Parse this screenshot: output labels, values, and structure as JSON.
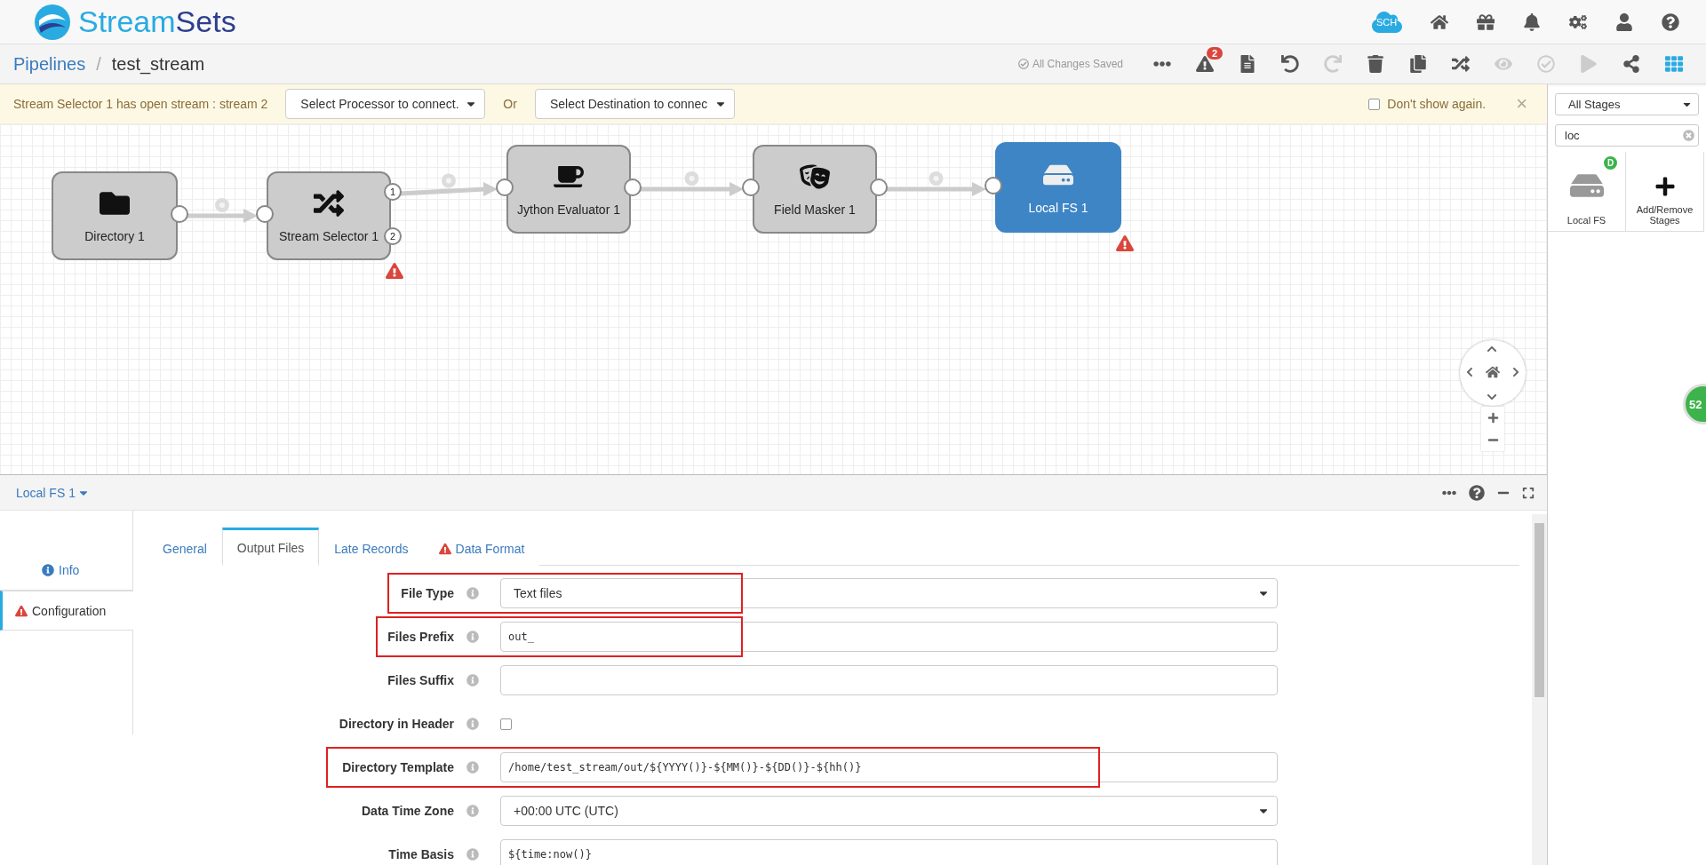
{
  "header": {
    "logo": [
      "Stream",
      "Sets"
    ],
    "icons": [
      {
        "kind": "cloud",
        "label": "SCH"
      },
      {
        "kind": "home"
      },
      {
        "kind": "gift"
      },
      {
        "kind": "bell"
      },
      {
        "kind": "cogs"
      },
      {
        "kind": "user"
      },
      {
        "kind": "help"
      }
    ]
  },
  "breadcrumb": {
    "root": "Pipelines",
    "separator": "/",
    "current": "test_stream"
  },
  "toolbar": {
    "status": "All Changes Saved",
    "buttons": [
      {
        "kind": "more",
        "disabled": false
      },
      {
        "kind": "issues",
        "disabled": false,
        "badge": "2"
      },
      {
        "kind": "file",
        "disabled": false
      },
      {
        "kind": "undo",
        "disabled": false
      },
      {
        "kind": "redo",
        "disabled": true
      },
      {
        "kind": "trash",
        "disabled": false
      },
      {
        "kind": "copy",
        "disabled": false
      },
      {
        "kind": "shuffle",
        "disabled": false
      },
      {
        "kind": "eye",
        "disabled": true
      },
      {
        "kind": "check",
        "disabled": true
      },
      {
        "kind": "play",
        "disabled": true
      },
      {
        "kind": "share",
        "disabled": false
      },
      {
        "kind": "grid",
        "disabled": false
      }
    ]
  },
  "notice": {
    "message": "Stream Selector 1 has open stream : stream 2",
    "processor_select": "Select Processor to connect.",
    "or": "Or",
    "destination_select": "Select Destination to connec",
    "dont_show": {
      "label": "Don't show again.",
      "checked": false
    },
    "close": "×"
  },
  "canvas": {
    "nodes": [
      {
        "label": "Directory 1",
        "kind": "folder",
        "selected": false,
        "warning": false
      },
      {
        "label": "Stream Selector 1",
        "kind": "selector",
        "selected": false,
        "warning": true,
        "outputs": [
          "1",
          "2"
        ]
      },
      {
        "label": "Jython Evaluator 1",
        "kind": "python",
        "selected": false,
        "warning": false
      },
      {
        "label": "Field Masker 1",
        "kind": "mask",
        "selected": false,
        "warning": false
      },
      {
        "label": "Local FS 1",
        "kind": "disk",
        "selected": true,
        "warning": true
      }
    ],
    "bubble": "52"
  },
  "stage_panel": {
    "filter": "All Stages",
    "search": "loc",
    "stages": [
      {
        "label": "Local FS",
        "kind": "disk",
        "badge": "D"
      },
      {
        "label": "Add/Remove Stages",
        "kind": "add"
      }
    ]
  },
  "detail": {
    "title": "Local FS 1",
    "side_tabs": [
      {
        "label": "Info",
        "kind": "info",
        "selected": false
      },
      {
        "label": "Configuration",
        "kind": "warning",
        "selected": true
      }
    ],
    "tabs": [
      {
        "label": "General",
        "selected": false,
        "warning": false
      },
      {
        "label": "Output Files",
        "selected": true,
        "warning": false
      },
      {
        "label": "Late Records",
        "selected": false,
        "warning": false
      },
      {
        "label": "Data Format",
        "selected": false,
        "warning": true
      }
    ],
    "fields": [
      {
        "label": "File Type",
        "kind": "select",
        "value": "Text files",
        "highlighted": true
      },
      {
        "label": "Files Prefix",
        "kind": "text",
        "value": "out_",
        "highlighted": true
      },
      {
        "label": "Files Suffix",
        "kind": "text",
        "highlighted": false
      },
      {
        "label": "Directory in Header",
        "kind": "checkbox",
        "checked": false,
        "highlighted": false
      },
      {
        "label": "Directory Template",
        "kind": "text",
        "value": "/home/test_stream/out/${YYYY()}-${MM()}-${DD()}-${hh()}",
        "highlighted": true
      },
      {
        "label": "Data Time Zone",
        "kind": "select",
        "value": "+00:00 UTC (UTC)",
        "highlighted": false
      },
      {
        "label": "Time Basis",
        "kind": "text",
        "value": "${time:now()}",
        "highlighted": false
      }
    ]
  }
}
